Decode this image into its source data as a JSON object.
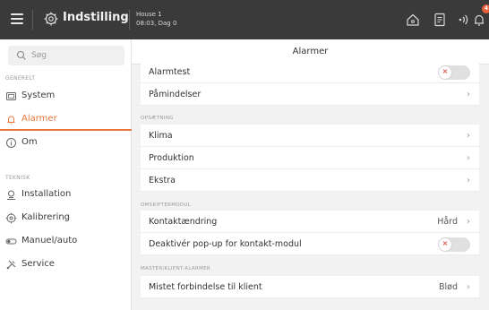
{
  "topbar": {
    "title": "Indstilling",
    "house_line1": "House 1",
    "house_line2": "08:03, Dag 0",
    "notification_count": "4"
  },
  "colors": {
    "accent": "#e8763c",
    "topbar_bg": "#3a3a3a",
    "badge": "#e8603c",
    "toggle_off_x": "#e2554b"
  },
  "sidebar": {
    "search_placeholder": "Søg",
    "section_general": "GENERELT",
    "section_technical": "TEKNISK",
    "items": [
      {
        "label": "System",
        "icon": "system-icon"
      },
      {
        "label": "Alarmer",
        "icon": "bell-icon",
        "active": true
      },
      {
        "label": "Om",
        "icon": "info-icon"
      },
      {
        "label": "Installation",
        "icon": "installation-icon"
      },
      {
        "label": "Kalibrering",
        "icon": "calibration-icon"
      },
      {
        "label": "Manuel/auto",
        "icon": "manual-auto-icon"
      },
      {
        "label": "Service",
        "icon": "service-icon"
      }
    ]
  },
  "main": {
    "title": "Alarmer",
    "rows_top": [
      {
        "label": "Alarmtest",
        "toggle": "off"
      },
      {
        "label": "Påmindelser",
        "chevron": "›"
      }
    ],
    "group_setup": "OPSÆTNING",
    "rows_setup": [
      {
        "label": "Klima",
        "chevron": "›"
      },
      {
        "label": "Produktion",
        "chevron": "›"
      },
      {
        "label": "Ekstra",
        "chevron": "›"
      }
    ],
    "group_switch": "OMSKIFTERMODUL",
    "rows_switch": [
      {
        "label": "Kontaktændring",
        "value": "Hård",
        "chevron": "›"
      },
      {
        "label": "Deaktivér pop-up for kontakt-modul",
        "toggle": "off"
      }
    ],
    "group_master": "MASTER/KLIENT-ALARMER",
    "rows_master": [
      {
        "label": "Mistet forbindelse til klient",
        "value": "Blød",
        "chevron": "›"
      }
    ],
    "toggle_off_symbol": "×"
  }
}
